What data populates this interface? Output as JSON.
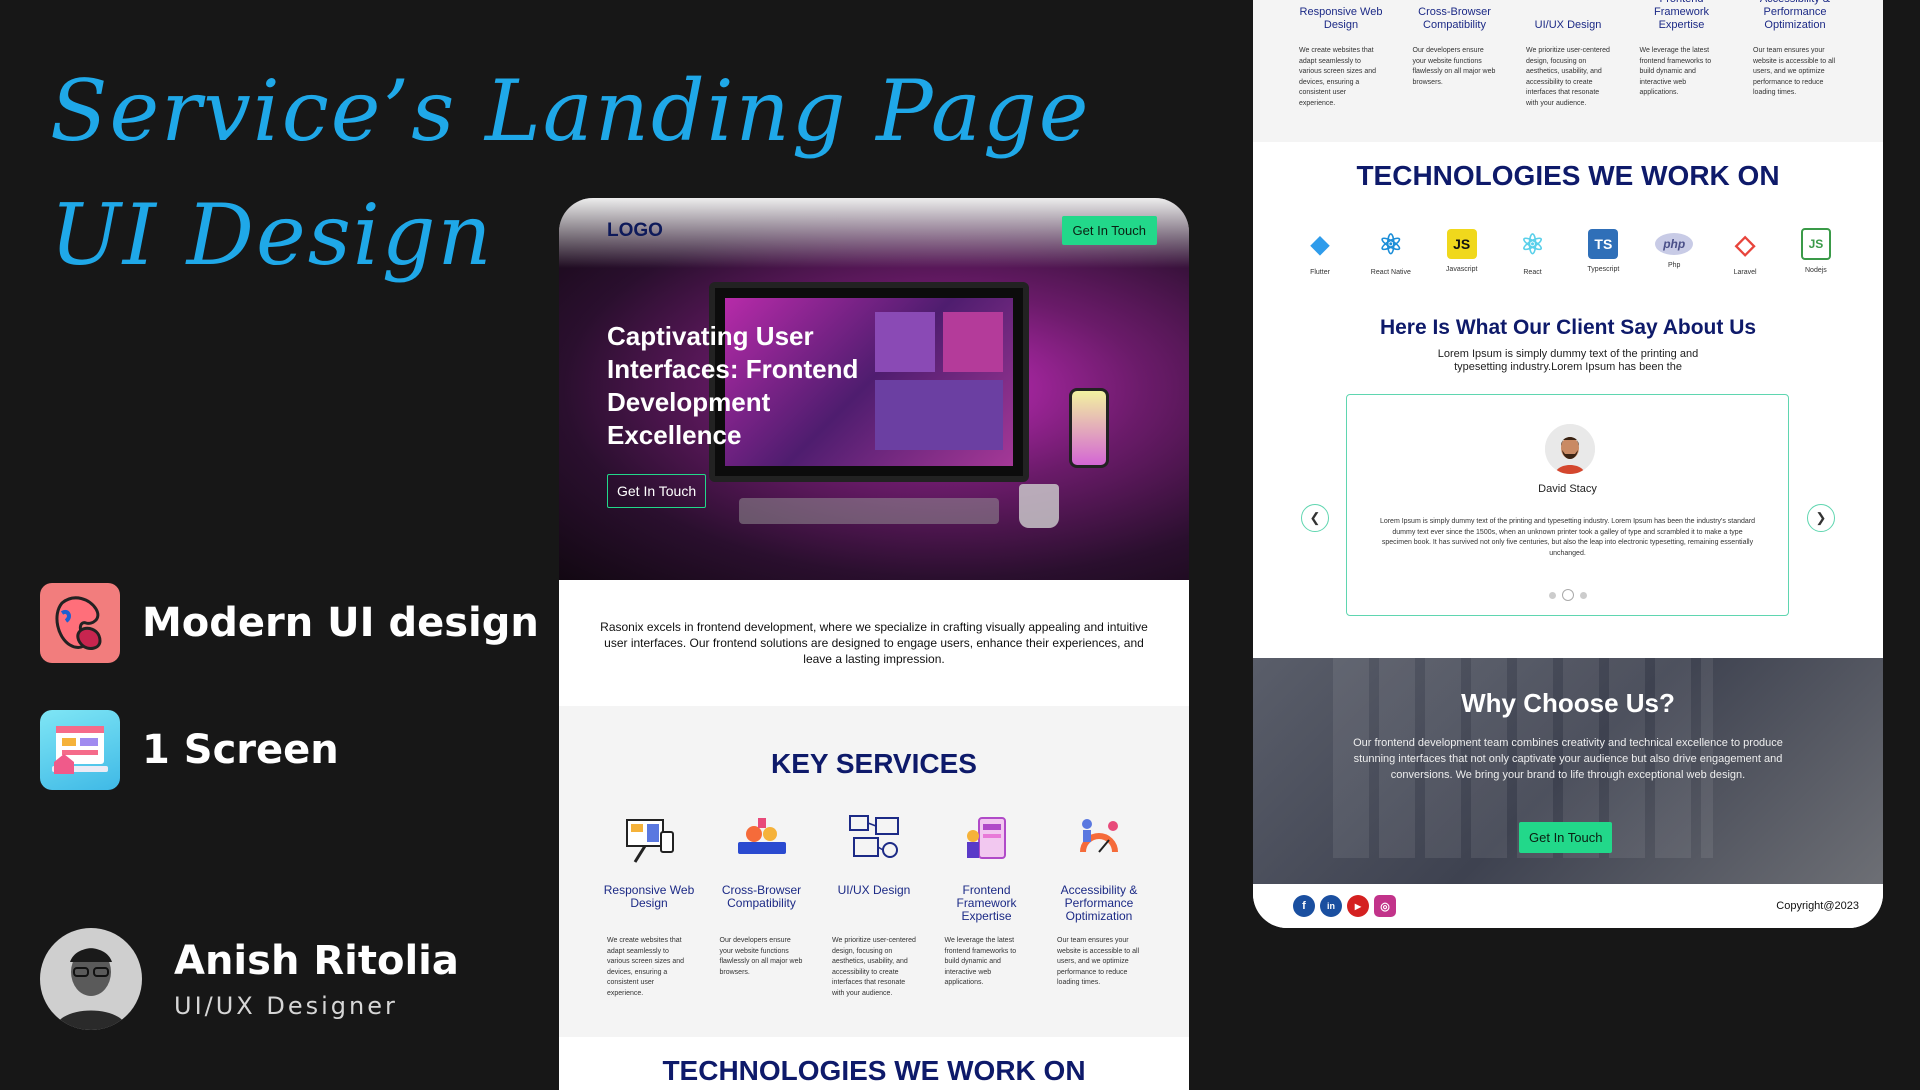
{
  "presentation": {
    "title_line1": "Service’s Landing Page",
    "title_line2": "UI Design",
    "features": [
      {
        "label": "Modern UI design",
        "icon": "blob-app-icon"
      },
      {
        "label": "1 Screen",
        "icon": "screen-app-icon"
      }
    ],
    "author": {
      "name": "Anish Ritolia",
      "role": "UI/UX Designer"
    }
  },
  "colors": {
    "accent": "#1fa8e8",
    "brand_navy": "#0e1a6a",
    "cta_green": "#22d88a",
    "background": "#171717"
  },
  "landing": {
    "logo": "LOGO",
    "nav_cta": "Get In Touch",
    "hero_title": "Captivating User Interfaces: Frontend Development Excellence",
    "hero_cta": "Get In Touch",
    "intro": "Rasonix excels in frontend development, where we specialize in crafting visually appealing and intuitive user interfaces. Our frontend solutions are designed to engage users, enhance their experiences, and leave a lasting impression.",
    "services_title": "KEY SERVICES",
    "services": [
      {
        "name": "Responsive Web Design",
        "desc": "We create websites that adapt seamlessly to various screen sizes and devices, ensuring a consistent user experience."
      },
      {
        "name": "Cross-Browser Compatibility",
        "desc": "Our developers ensure your website functions flawlessly on all major web browsers."
      },
      {
        "name": "UI/UX Design",
        "desc": "We prioritize user-centered design, focusing on aesthetics, usability, and accessibility to create interfaces that resonate with your audience."
      },
      {
        "name": "Frontend Framework Expertise",
        "desc": "We leverage the latest frontend frameworks to build dynamic and interactive web applications."
      },
      {
        "name": "Accessibility & Performance Optimization",
        "desc": "Our team ensures your website is accessible to all users, and we optimize performance to reduce loading times."
      }
    ],
    "tech_title": "TECHNOLOGIES WE WORK ON",
    "technologies": [
      {
        "label": "Flutter",
        "glyph": "◆",
        "color": "#2f9ceb"
      },
      {
        "label": "React Native",
        "glyph": "⚛",
        "color": "#1c8ed8"
      },
      {
        "label": "Javascript",
        "glyph": "JS",
        "color": "#f0d81c"
      },
      {
        "label": "React",
        "glyph": "⚛",
        "color": "#5ad0ea"
      },
      {
        "label": "Typescript",
        "glyph": "TS",
        "color": "#2f6fb8"
      },
      {
        "label": "Php",
        "glyph": "php",
        "color": "#8a8fbf"
      },
      {
        "label": "Laravel",
        "glyph": "◇",
        "color": "#e8453c"
      },
      {
        "label": "Nodejs",
        "glyph": "JS",
        "color": "#3a9a48"
      }
    ],
    "testimonials_title": "Here Is What Our Client  Say About Us",
    "testimonials_sub": "Lorem Ipsum is simply dummy text of the printing and typesetting industry.Lorem Ipsum has been the",
    "testimonial": {
      "name": "David Stacy",
      "text": "Lorem Ipsum is simply dummy text of the printing and typesetting industry. Lorem Ipsum has been the industry's standard dummy text ever since the 1500s, when an unknown printer took a galley of type and scrambled it to make a type specimen book. It has survived not only five centuries, but also the leap into electronic typesetting, remaining essentially unchanged."
    },
    "why_title": "Why Choose Us?",
    "why_text": "Our frontend development team combines creativity and technical excellence to produce stunning interfaces that not only captivate your audience but also drive engagement and conversions. We bring your brand to life through exceptional web design.",
    "why_cta": "Get In Touch",
    "socials": [
      {
        "glyph": "f",
        "name": "facebook-icon",
        "color": "#1a4fa0"
      },
      {
        "glyph": "in",
        "name": "linkedin-icon",
        "color": "#1a4fa0"
      },
      {
        "glyph": "▶",
        "name": "youtube-icon",
        "color": "#d42020"
      },
      {
        "glyph": "◎",
        "name": "instagram-icon",
        "color": "#c2338a"
      }
    ],
    "copyright": "Copyright@2023"
  }
}
